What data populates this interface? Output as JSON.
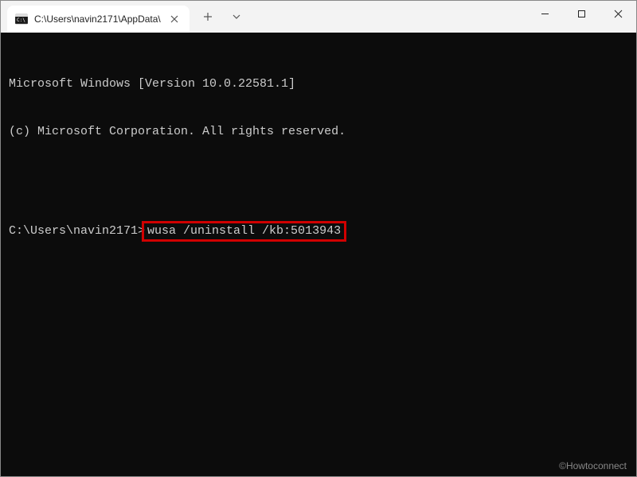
{
  "window": {
    "tab_title": "C:\\Users\\navin2171\\AppData\\",
    "new_tab_tooltip": "New tab",
    "dropdown_tooltip": "Open a new tab"
  },
  "terminal": {
    "line1": "Microsoft Windows [Version 10.0.22581.1]",
    "line2": "(c) Microsoft Corporation. All rights reserved.",
    "prompt": "C:\\Users\\navin2171>",
    "command": "wusa /uninstall /kb:5013943"
  },
  "watermark": "©Howtoconnect"
}
